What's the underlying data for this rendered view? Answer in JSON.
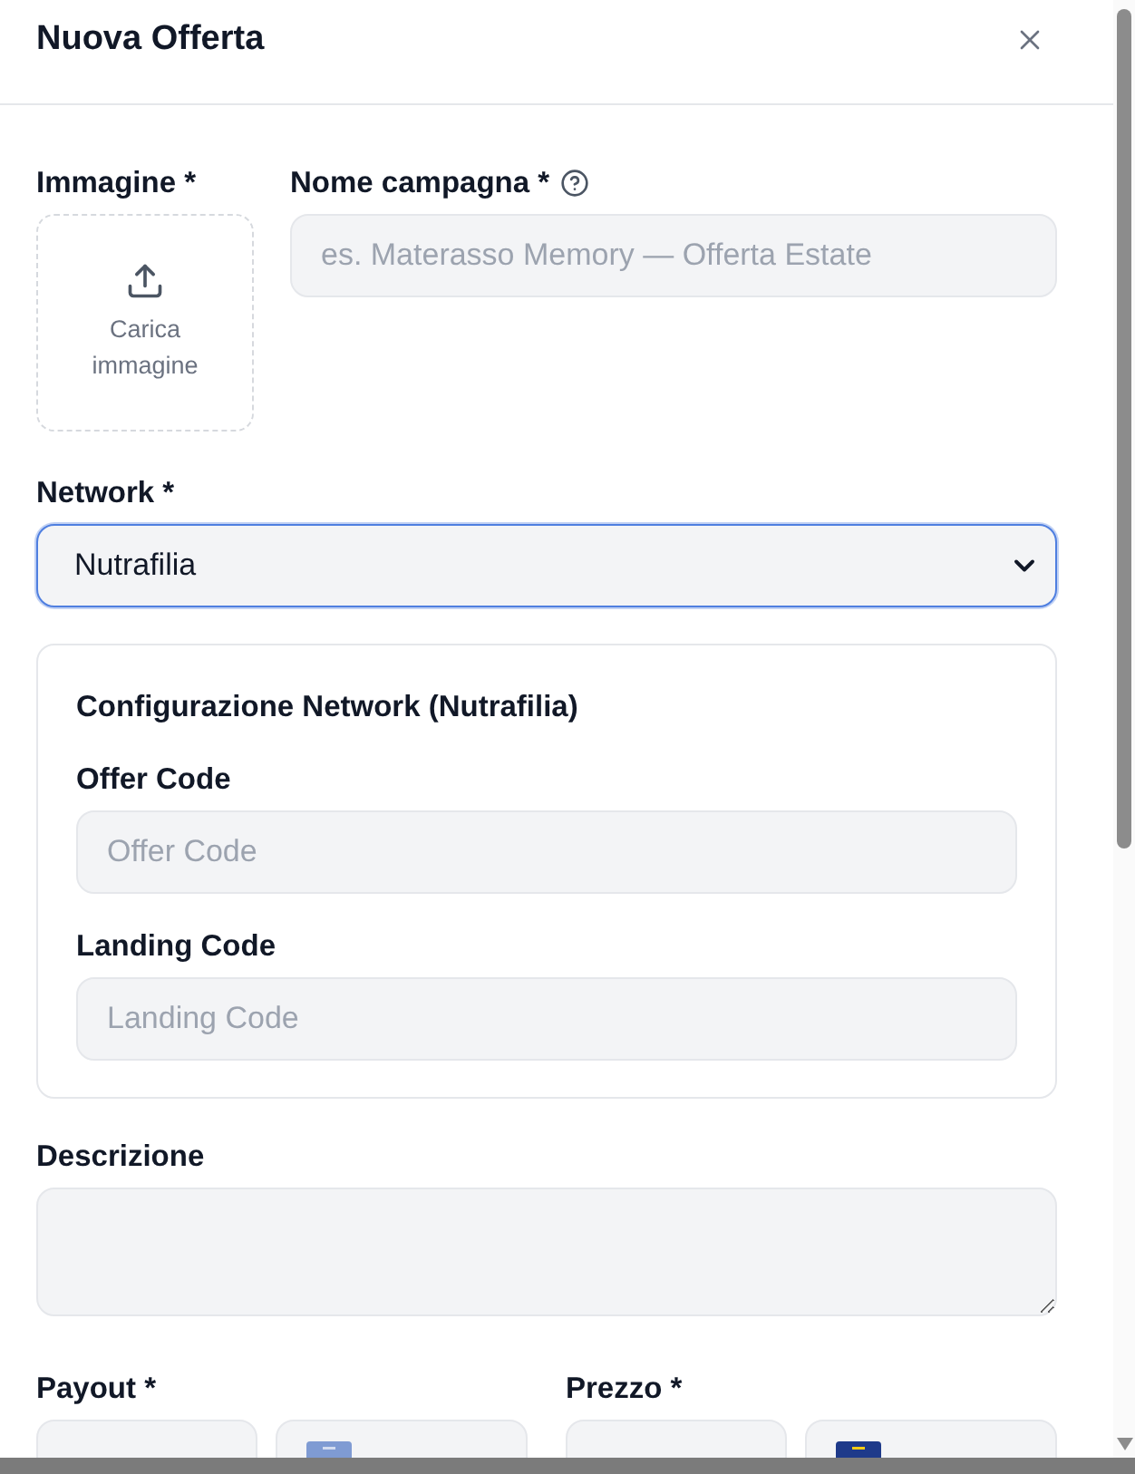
{
  "dialog": {
    "title": "Nuova Offerta"
  },
  "image": {
    "label": "Immagine *",
    "upload_text": "Carica immagine"
  },
  "campaign_name": {
    "label": "Nome campagna *",
    "placeholder": "es. Materasso Memory — Offerta Estate"
  },
  "network": {
    "label": "Network *",
    "value": "Nutrafilia",
    "focused": true
  },
  "network_config": {
    "title": "Configurazione Network (Nutrafilia)",
    "fields": [
      {
        "label": "Offer Code",
        "placeholder": "Offer Code"
      },
      {
        "label": "Landing Code",
        "placeholder": "Landing Code"
      }
    ]
  },
  "description": {
    "label": "Descrizione"
  },
  "amounts": [
    {
      "label": "Payout *",
      "currency_disabled": true
    },
    {
      "label": "Prezzo *",
      "currency_disabled": false
    }
  ]
}
